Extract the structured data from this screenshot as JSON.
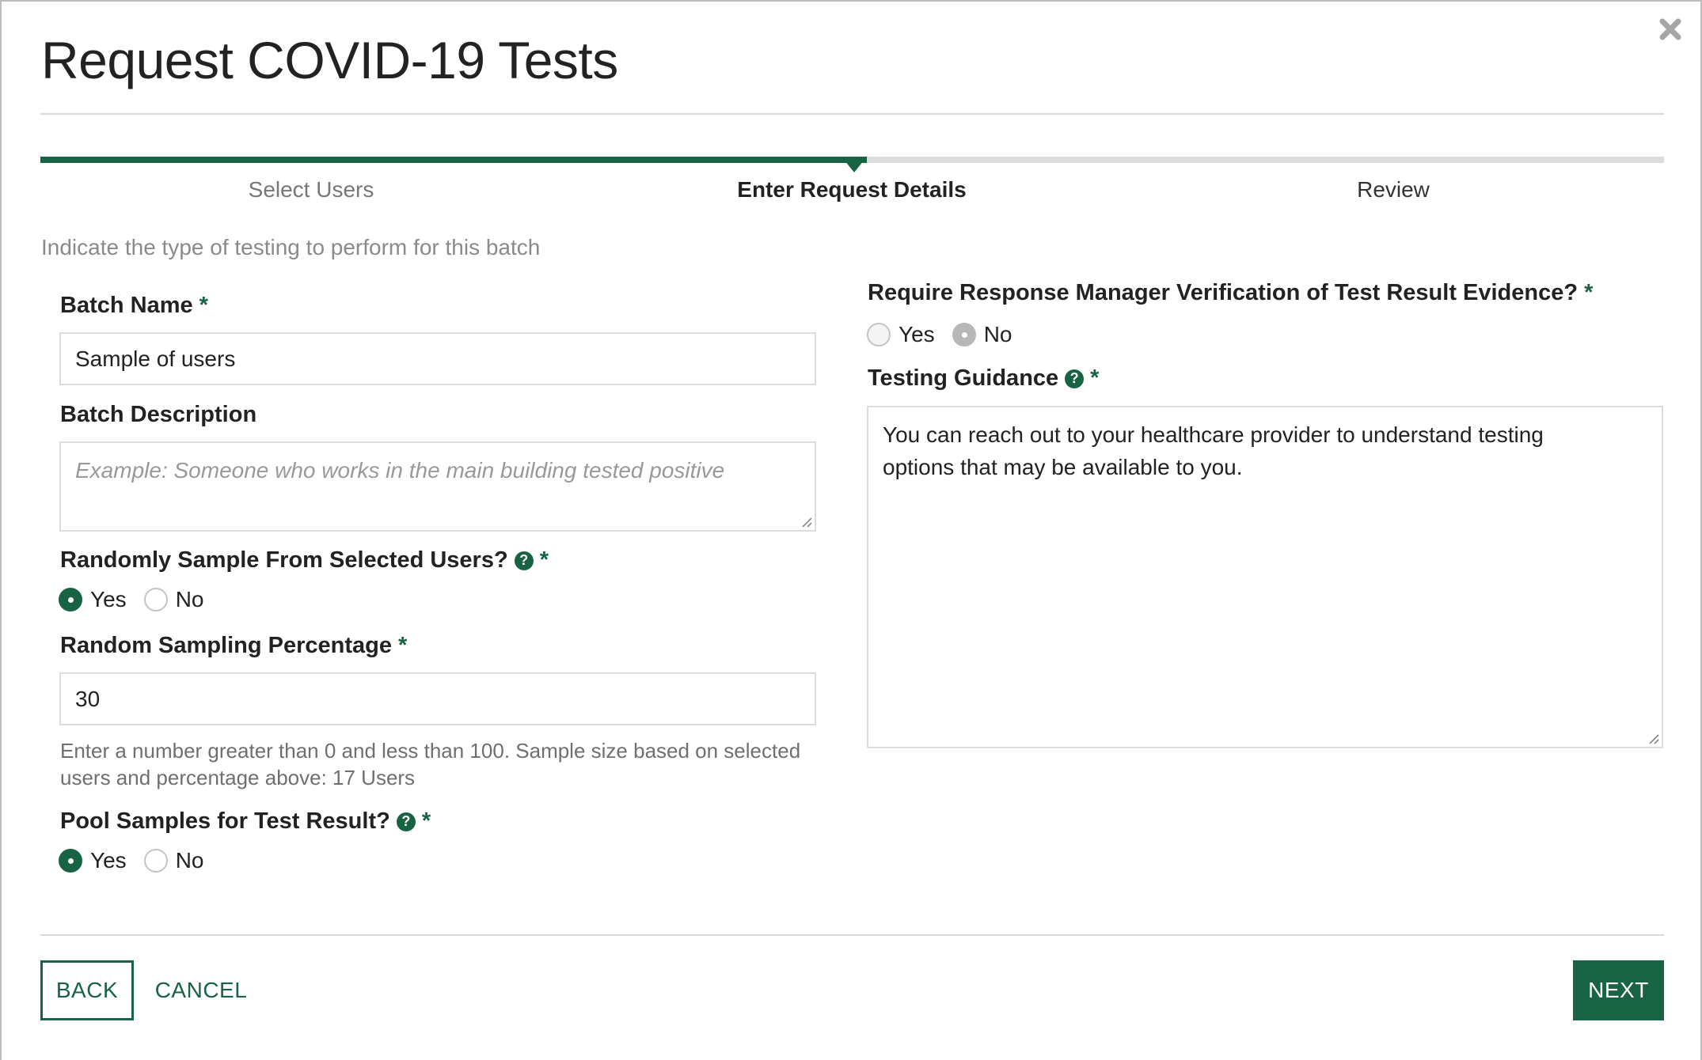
{
  "dialog": {
    "title": "Request COVID-19 Tests",
    "close_icon": "close-icon"
  },
  "stepper": {
    "steps": [
      {
        "label": "Select Users",
        "state": "completed"
      },
      {
        "label": "Enter Request Details",
        "state": "active"
      },
      {
        "label": "Review",
        "state": "upcoming"
      }
    ]
  },
  "intro": "Indicate the type of testing to perform for this batch",
  "form": {
    "required_marker": "*",
    "help_icon_glyph": "?",
    "batch_name": {
      "label": "Batch Name",
      "value": "Sample of users"
    },
    "batch_description": {
      "label": "Batch Description",
      "value": "",
      "placeholder": "Example: Someone who works in the main building tested positive"
    },
    "random_sample": {
      "label": "Randomly Sample From Selected Users?",
      "options": [
        "Yes",
        "No"
      ],
      "selected": "Yes"
    },
    "sampling_percentage": {
      "label": "Random Sampling Percentage",
      "value": "30",
      "helper": "Enter a number greater than 0 and less than 100. Sample size based on selected users and percentage above: 17 Users"
    },
    "pool_samples": {
      "label": "Pool Samples for Test Result?",
      "options": [
        "Yes",
        "No"
      ],
      "selected": "Yes"
    },
    "require_verification": {
      "label": "Require Response Manager Verification of Test Result Evidence?",
      "options": [
        "Yes",
        "No"
      ],
      "selected": "No",
      "disabled": true
    },
    "testing_guidance": {
      "label": "Testing Guidance",
      "value": "You can reach out to your healthcare provider to understand testing options that may be available to you."
    }
  },
  "footer": {
    "back_label": "BACK",
    "cancel_label": "CANCEL",
    "next_label": "NEXT"
  },
  "colors": {
    "accent": "#196345",
    "border": "#dcdcdc",
    "muted_text": "#8a8a8a"
  }
}
